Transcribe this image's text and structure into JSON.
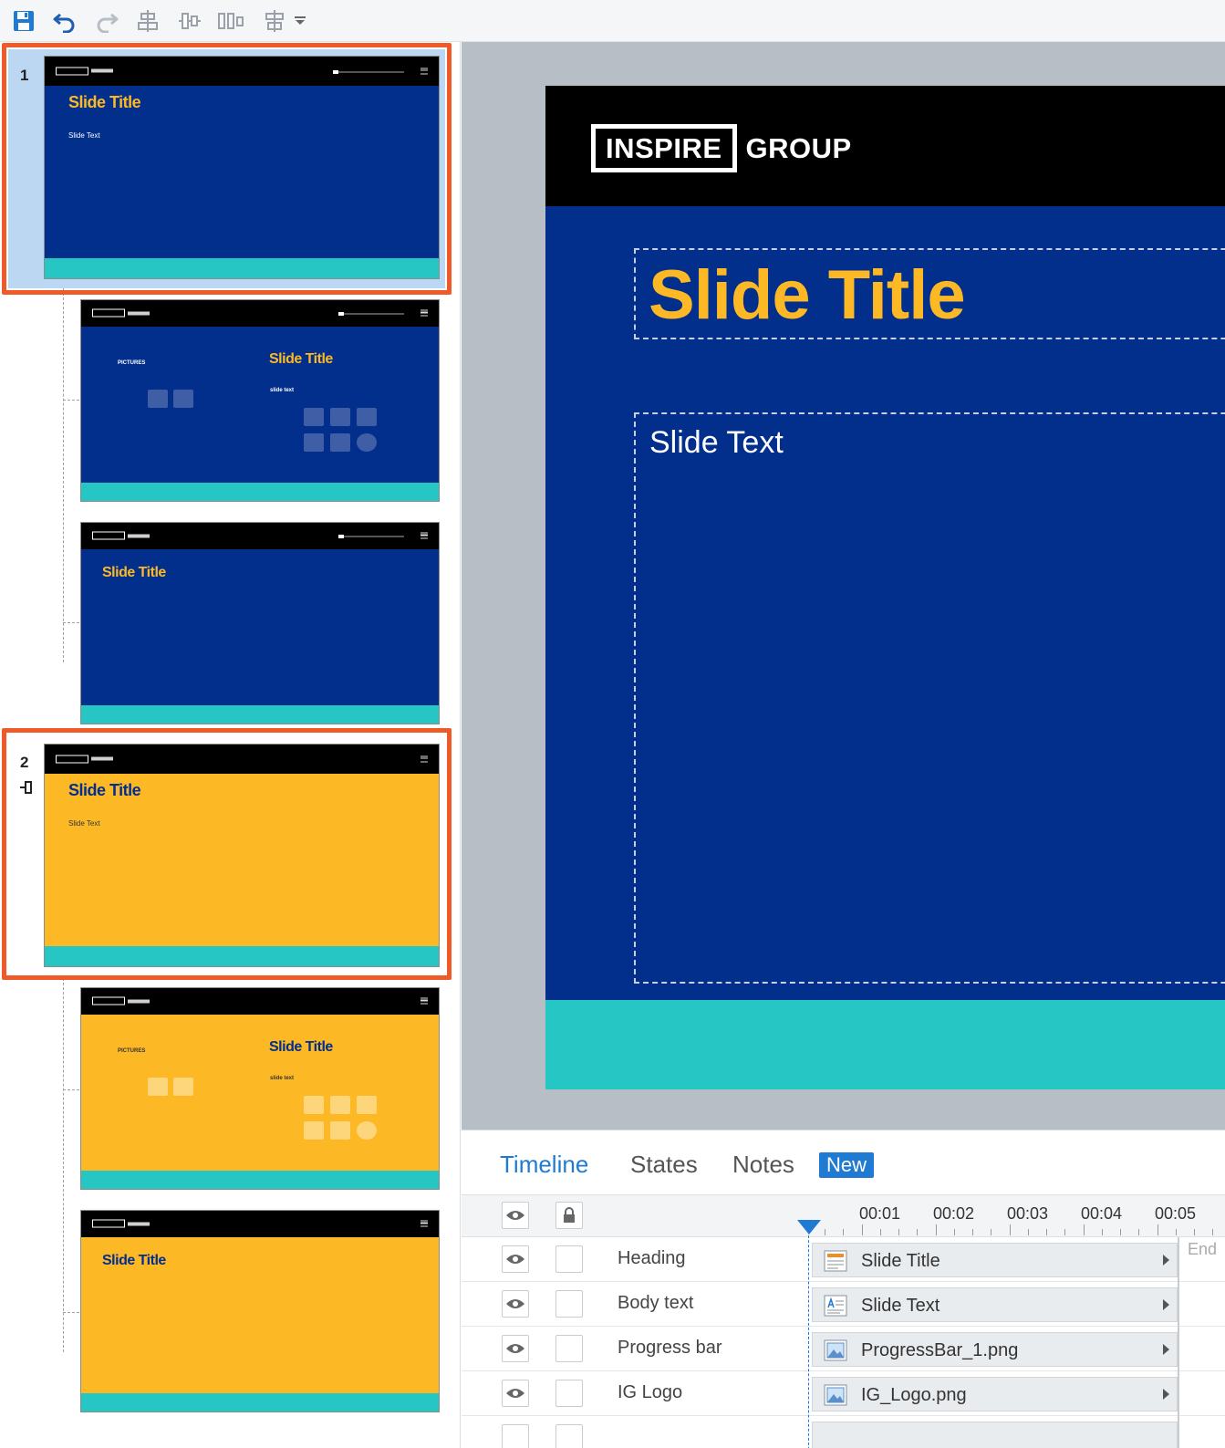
{
  "toolbar": {
    "buttons": [
      {
        "name": "save",
        "icon": "save-icon"
      },
      {
        "name": "undo",
        "icon": "undo-icon"
      },
      {
        "name": "redo",
        "icon": "redo-icon"
      },
      {
        "name": "align-center",
        "icon": "align-center-icon"
      },
      {
        "name": "align-middle",
        "icon": "align-middle-icon"
      },
      {
        "name": "distribute",
        "icon": "distribute-icon"
      },
      {
        "name": "arrange",
        "icon": "arrange-icon"
      }
    ]
  },
  "scenes": [
    {
      "number": "1",
      "thumb_title": "Slide Title",
      "thumb_text": "Slide Text",
      "layouts": [
        {
          "title": "Slide Title",
          "small_left": "PICTURES",
          "small_right": "slide text"
        },
        {
          "title": "Slide Title"
        }
      ]
    },
    {
      "number": "2",
      "thumb_title": "Slide Title",
      "thumb_text": "Slide Text",
      "layouts": [
        {
          "title": "Slide Title",
          "small_left": "PICTURES",
          "small_right": "slide text"
        },
        {
          "title": "Slide Title"
        }
      ]
    }
  ],
  "colors": {
    "blue": "#022e8c",
    "yellow": "#fcb925",
    "teal": "#25c6c3",
    "accent": "#1f7bd1",
    "selection": "#f05a28"
  },
  "slide": {
    "logo_box": "INSPIRE",
    "logo_text": "GROUP",
    "title": "Slide Title",
    "text": "Slide Text"
  },
  "timeline": {
    "tabs": [
      "Timeline",
      "States",
      "Notes"
    ],
    "new_badge": "New",
    "ruler": [
      "00:01",
      "00:02",
      "00:03",
      "00:04",
      "00:05"
    ],
    "end_label": "End",
    "rows": [
      {
        "name": "Heading",
        "bar": "Slide Title",
        "icon": "title-icon"
      },
      {
        "name": "Body text",
        "bar": "Slide Text",
        "icon": "text-icon"
      },
      {
        "name": "Progress bar",
        "bar": "ProgressBar_1.png",
        "icon": "image-icon"
      },
      {
        "name": "IG Logo",
        "bar": "IG_Logo.png",
        "icon": "image-icon"
      }
    ]
  }
}
